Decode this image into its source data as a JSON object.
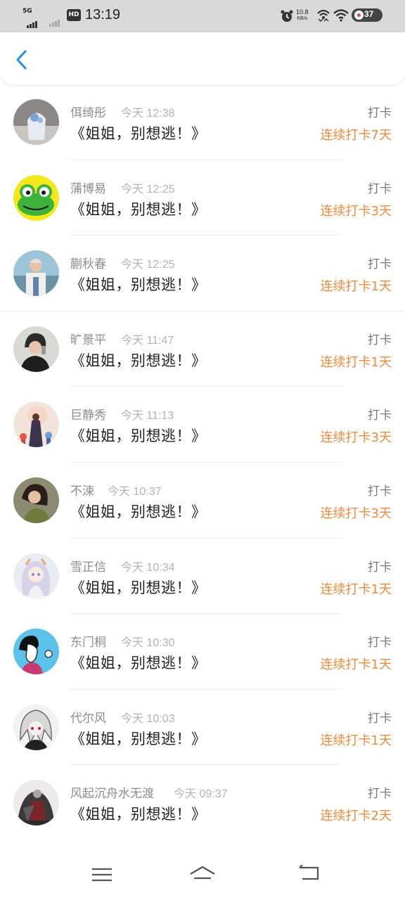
{
  "status_bar": {
    "network": "5G",
    "hd_badge": "HD",
    "time": "13:19",
    "speed_value": "10.8",
    "speed_unit": "KB/s",
    "battery": "37"
  },
  "feed": [
    {
      "name": "佴绮彤",
      "time": "今天 12:38",
      "title": "《姐姐，别想逃！》",
      "tag": "打卡",
      "streak": "连续打卡7天"
    },
    {
      "name": "蒲博易",
      "time": "今天 12:25",
      "title": "《姐姐，别想逃！》",
      "tag": "打卡",
      "streak": "连续打卡3天"
    },
    {
      "name": "蒯秋春",
      "time": "今天 12:25",
      "title": "《姐姐，别想逃！》",
      "tag": "打卡",
      "streak": "连续打卡1天"
    },
    {
      "name": "旷景平",
      "time": "今天 11:47",
      "title": "《姐姐，别想逃！》",
      "tag": "打卡",
      "streak": "连续打卡1天"
    },
    {
      "name": "巨静秀",
      "time": "今天 11:13",
      "title": "《姐姐，别想逃！》",
      "tag": "打卡",
      "streak": "连续打卡3天"
    },
    {
      "name": "不涑",
      "time": "今天 10:37",
      "title": "《姐姐，别想逃！》",
      "tag": "打卡",
      "streak": "连续打卡3天"
    },
    {
      "name": "雪正信",
      "time": "今天 10:34",
      "title": "《姐姐，别想逃！》",
      "tag": "打卡",
      "streak": "连续打卡1天"
    },
    {
      "name": "东门桐",
      "time": "今天 10:30",
      "title": "《姐姐，别想逃！》",
      "tag": "打卡",
      "streak": "连续打卡1天"
    },
    {
      "name": "代尔风",
      "time": "今天 10:03",
      "title": "《姐姐，别想逃！》",
      "tag": "打卡",
      "streak": "连续打卡1天"
    },
    {
      "name": "风起沉舟水无渡",
      "time": "今天 09:37",
      "title": "《姐姐，别想逃！》",
      "tag": "打卡",
      "streak": "连续打卡2天"
    }
  ],
  "colors": {
    "accent_blue": "#2a8ee8",
    "streak_orange": "#f0893a"
  },
  "icons": {
    "back": "chevron-left-icon",
    "menu": "menu-icon",
    "home": "home-icon",
    "return": "return-icon"
  }
}
